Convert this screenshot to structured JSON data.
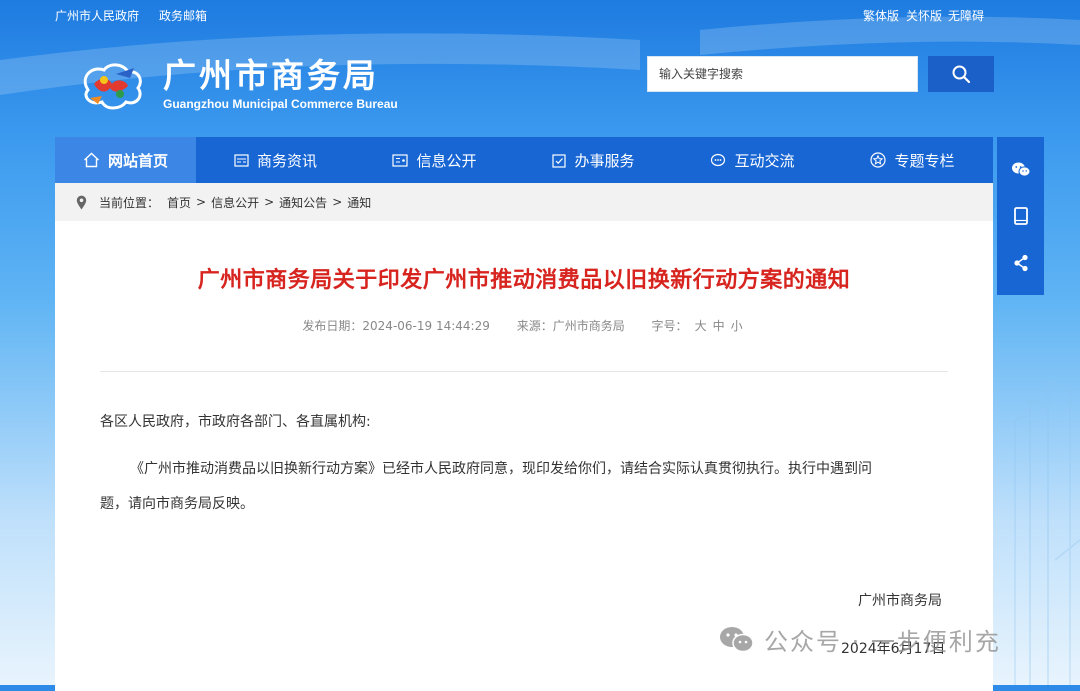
{
  "topbar": {
    "gov_link": "广州市人民政府",
    "mail_link": "政务邮箱",
    "traditional": "繁体版",
    "care": "关怀版",
    "accessible": "无障碍"
  },
  "header": {
    "title": "广州市商务局",
    "subtitle": "Guangzhou Municipal Commerce Bureau",
    "search_placeholder": "输入关键字搜索"
  },
  "nav": {
    "items": [
      {
        "label": "网站首页",
        "icon": "home-icon"
      },
      {
        "label": "商务资讯",
        "icon": "news-icon"
      },
      {
        "label": "信息公开",
        "icon": "info-icon"
      },
      {
        "label": "办事服务",
        "icon": "service-icon"
      },
      {
        "label": "互动交流",
        "icon": "chat-icon"
      },
      {
        "label": "专题专栏",
        "icon": "star-icon"
      }
    ]
  },
  "breadcrumb": {
    "prefix": "当前位置：",
    "items": [
      "首页",
      "信息公开",
      "通知公告",
      "通知"
    ],
    "separator": ">"
  },
  "article": {
    "title": "广州市商务局关于印发广州市推动消费品以旧换新行动方案的通知",
    "date_label": "发布日期：",
    "date": "2024-06-19 14:44:29",
    "source_label": "来源：",
    "source": "广州市商务局",
    "font_label": "字号：",
    "font_large": "大",
    "font_medium": "中",
    "font_small": "小",
    "salutation": "各区人民政府，市政府各部门、各直属机构:",
    "body_line1": "《广州市推动消费品以旧换新行动方案》已经市人民政府同意，现印发给你们，请结合实际认真贯彻执行。执行中遇到问",
    "body_line2": "题，请向市商务局反映。",
    "signature": "广州市商务局",
    "sign_date": "2024年6月17日"
  },
  "watermark": {
    "text": "公众号 · 一步便利充"
  },
  "share": {
    "items": [
      "wechat-icon",
      "mobile-icon",
      "share-icon"
    ]
  },
  "colors": {
    "nav": "#1766d4",
    "nav_active": "#3c87e6",
    "title_red": "#d7241f",
    "search_button": "#1b5fc9"
  }
}
